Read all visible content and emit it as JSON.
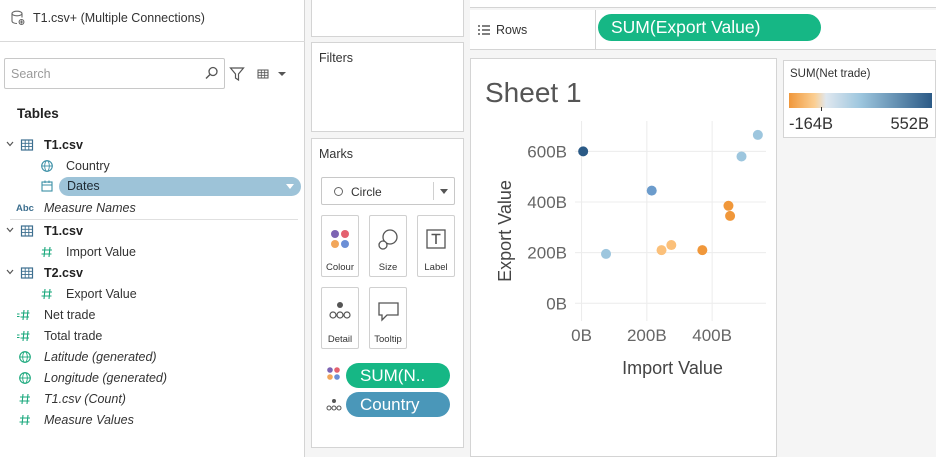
{
  "datasource": {
    "label": "T1.csv+ (Multiple Connections)"
  },
  "search": {
    "placeholder": "Search"
  },
  "tables_heading": "Tables",
  "fields": {
    "t1a": "T1.csv",
    "country": "Country",
    "dates": "Dates",
    "measure_names": "Measure Names",
    "t1b": "T1.csv",
    "import_value": "Import Value",
    "t2": "T2.csv",
    "export_value": "Export Value",
    "net_trade": "Net trade",
    "total_trade": "Total trade",
    "latitude": "Latitude (generated)",
    "longitude": "Longitude (generated)",
    "t1_count": "T1.csv (Count)",
    "measure_values": "Measure Values",
    "abc": "Abc"
  },
  "filters": {
    "title": "Filters"
  },
  "marks": {
    "title": "Marks",
    "mark_type": "Circle",
    "buttons": {
      "colour": "Colour",
      "size": "Size",
      "label": "Label",
      "detail": "Detail",
      "tooltip": "Tooltip"
    },
    "pills": {
      "color_pill": "SUM(N..",
      "detail_pill": "Country"
    }
  },
  "rows": {
    "label": "Rows",
    "pill": "SUM(Export Value)"
  },
  "sheet": {
    "title": "Sheet 1"
  },
  "legend": {
    "title": "SUM(Net trade)",
    "min_label": "-164B",
    "max_label": "552B"
  },
  "colors": {
    "pill_green": "#16b785",
    "pill_blue": "#4a97b9",
    "dates_pill": "#9dc3d8",
    "orange": "#f0973a",
    "dark_blue": "#2b5a86"
  },
  "chart_data": {
    "type": "scatter",
    "xlabel": "Import Value",
    "ylabel": "Export Value",
    "xticks": [
      "0B",
      "200B",
      "400B"
    ],
    "yticks": [
      "0B",
      "200B",
      "400B",
      "600B"
    ],
    "xlim": [
      -20,
      565
    ],
    "ylim": [
      -70,
      720
    ],
    "points": [
      {
        "x": 5,
        "y": 600,
        "color": "#2b5a86"
      },
      {
        "x": 75,
        "y": 195,
        "color": "#9dc6de"
      },
      {
        "x": 215,
        "y": 445,
        "color": "#6c9ccc"
      },
      {
        "x": 245,
        "y": 210,
        "color": "#fbc07a"
      },
      {
        "x": 275,
        "y": 230,
        "color": "#fbc07a"
      },
      {
        "x": 370,
        "y": 210,
        "color": "#f0973a"
      },
      {
        "x": 450,
        "y": 385,
        "color": "#f0973a"
      },
      {
        "x": 455,
        "y": 345,
        "color": "#f0973a"
      },
      {
        "x": 490,
        "y": 580,
        "color": "#9dc6de"
      },
      {
        "x": 540,
        "y": 665,
        "color": "#9dc6de"
      }
    ]
  }
}
